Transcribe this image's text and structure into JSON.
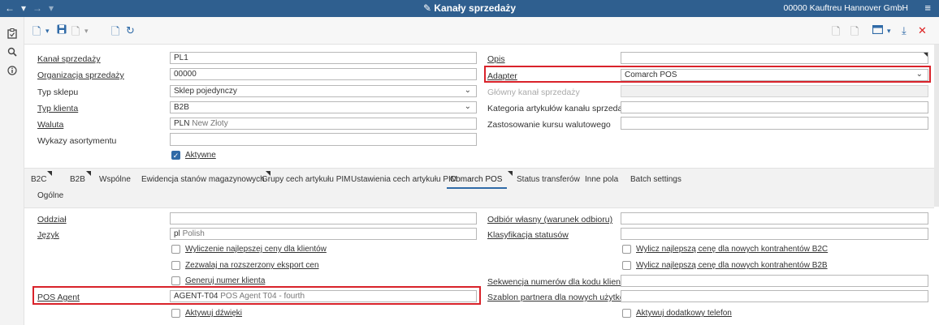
{
  "titlebar": {
    "nav_back": "←",
    "nav_caret": "▾",
    "nav_forward": "→",
    "title": "Kanały sprzedaży",
    "company": "00000  Kauftreu Hannover GmbH",
    "title_icon": "pencil-icon",
    "menu_icon": "hamburger-icon"
  },
  "rail": {
    "icons": [
      "clipboard-icon",
      "search-icon",
      "info-icon"
    ]
  },
  "toolbar": {
    "icons": [
      "new-document-icon",
      "dropdown-icon",
      "save-icon",
      "dropdown-icon",
      "save-as-icon",
      "dropdown-icon",
      "copy-icon",
      "refresh-icon"
    ],
    "right_icons": [
      "add-icon",
      "search-document-icon",
      "window-icon",
      "dropdown-icon",
      "expand-icon",
      "close-icon"
    ]
  },
  "form": {
    "left": [
      {
        "label": "Kanał sprzedaży",
        "value": "PL1",
        "sub": ""
      },
      {
        "label": "Organizacja sprzedaży",
        "value": "00000",
        "sub": ""
      },
      {
        "label": "Typ sklepu",
        "value": "Sklep pojedynczy",
        "sub": ""
      },
      {
        "label": "Typ klienta",
        "value": "B2B",
        "sub": ""
      },
      {
        "label": "Waluta",
        "value": "PLN",
        "sub": "New Złoty"
      },
      {
        "label": "Wykazy asortymentu",
        "value": "",
        "sub": ""
      }
    ],
    "active_label": "Aktywne",
    "right": [
      {
        "label": "Opis",
        "value": ""
      },
      {
        "label": "Adapter",
        "value": "Comarch POS"
      },
      {
        "label": "Główny kanał sprzedaży",
        "value": ""
      },
      {
        "label": "Kategoria artykułów kanału sprzedaży",
        "value": ""
      },
      {
        "label": "Zastosowanie kursu walutowego",
        "value": ""
      }
    ]
  },
  "tabs": {
    "row1": [
      "B2C",
      "B2B",
      "Wspólne",
      "Ewidencja stanów magazynowych",
      "Grupy cech artykułu PIM",
      "Ustawienia cech artykułu PIM",
      "Comarch POS",
      "Status transferów",
      "Inne pola",
      "Batch settings"
    ],
    "row2": [
      "Ogólne"
    ]
  },
  "pos": {
    "oddzial_label": "Oddział",
    "oddzial_value": "",
    "jezyk_label": "Język",
    "jezyk_value": "pl",
    "jezyk_sub": "Polish",
    "chk_left": [
      "Wyliczenie najlepszej ceny dla klientów",
      "Zezwalaj na rozszerzony eksport cen",
      "Generuj numer klienta"
    ],
    "pos_agent_label": "POS Agent",
    "pos_agent_value": "AGENT-T04",
    "pos_agent_sub": "POS Agent T04 - fourth",
    "chk_sound": "Aktywuj dźwięki",
    "odbior_label": "Odbiór własny (warunek odbioru)",
    "klas_label": "Klasyfikacja statusów",
    "chk_right": [
      "Wylicz najlepszą cenę dla nowych kontrahentów B2C",
      "Wylicz najlepszą cenę dla nowych kontrahentów B2B"
    ],
    "sekwencja_label": "Sekwencja numerów dla kodu klienta",
    "szablon_label": "Szablon partnera dla nowych użytkowni...",
    "chk_phone": "Aktywuj dodatkowy telefon"
  }
}
